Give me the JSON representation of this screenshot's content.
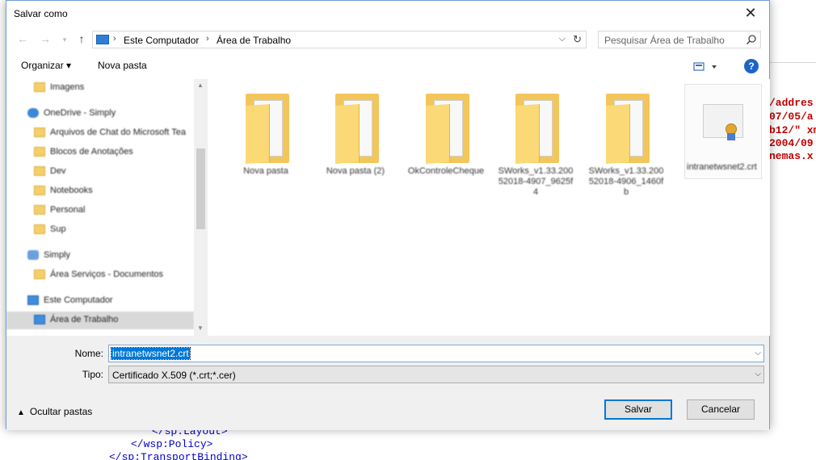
{
  "background_editor": {
    "lines_right": [
      "/addres",
      "07/05/a",
      "b12/\" xm",
      "2004/09",
      "nemas.x"
    ],
    "lines_bottom": [
      "</sp:Layout>",
      "</wsp:Policy>",
      "</sp:TransportBinding>"
    ]
  },
  "dialog": {
    "title": "Salvar como",
    "close_label": "✕"
  },
  "navigation": {
    "back": "←",
    "forward": "→",
    "up": "↑",
    "breadcrumb": [
      "Este Computador",
      "Área de Trabalho"
    ],
    "search_placeholder": "Pesquisar Área de Trabalho"
  },
  "toolbar": {
    "organize_label": "Organizar ▾",
    "new_folder_label": "Nova pasta",
    "help_label": "?"
  },
  "tree": [
    {
      "label": "Imagens",
      "icon": "folder-icon",
      "indent": 1
    },
    {
      "label": "OneDrive - Simply",
      "icon": "cloud-icon",
      "indent": 0
    },
    {
      "label": "Arquivos de Chat do Microsoft Tea",
      "icon": "folder-icon",
      "indent": 1
    },
    {
      "label": "Blocos de Anotações",
      "icon": "folder-icon",
      "indent": 1
    },
    {
      "label": "Dev",
      "icon": "folder-icon",
      "indent": 1
    },
    {
      "label": "Notebooks",
      "icon": "folder-icon",
      "indent": 1
    },
    {
      "label": "Personal",
      "icon": "folder-icon",
      "indent": 1
    },
    {
      "label": "Sup",
      "icon": "folder-icon",
      "indent": 1
    },
    {
      "label": "Simply",
      "icon": "person-icon",
      "indent": 0
    },
    {
      "label": "Área Serviços - Documentos",
      "icon": "folder-icon",
      "indent": 1
    },
    {
      "label": "Este Computador",
      "icon": "computer-icon",
      "indent": 0
    },
    {
      "label": "Área de Trabalho",
      "icon": "desktop-icon",
      "indent": 1,
      "selected": true
    }
  ],
  "files": [
    {
      "name": "Nova pasta",
      "type": "folder"
    },
    {
      "name": "Nova pasta (2)",
      "type": "folder"
    },
    {
      "name": "OkControleCheque",
      "type": "folder"
    },
    {
      "name": "SWorks_v1.33.20052018-4907_9625f4",
      "type": "folder"
    },
    {
      "name": "SWorks_v1.33.20052018-4906_1460fb",
      "type": "folder"
    },
    {
      "name": "intranetwsnet2.crt",
      "type": "certificate"
    }
  ],
  "form": {
    "name_label": "Nome:",
    "name_value": "intranetwsnet2.crt",
    "type_label": "Tipo:",
    "type_value": "Certificado X.509 (*.crt;*.cer)",
    "hide_folders_label": "Ocultar pastas",
    "save_label": "Salvar",
    "cancel_label": "Cancelar"
  }
}
